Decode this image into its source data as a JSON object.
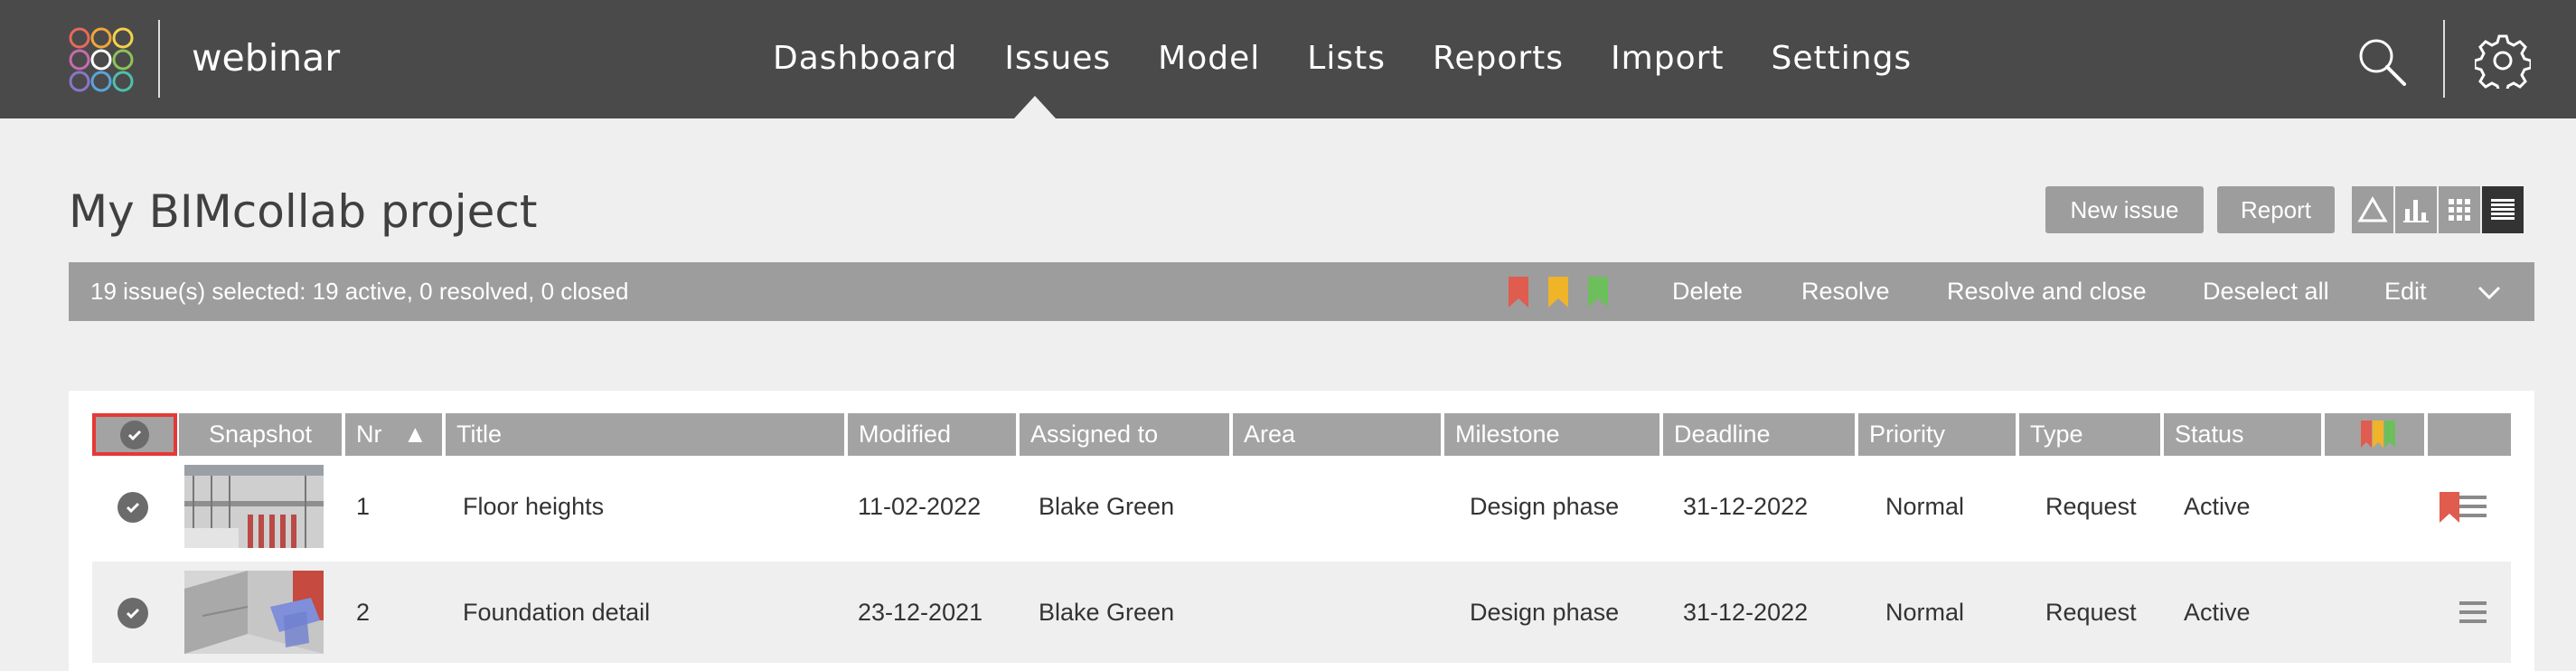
{
  "app": {
    "project_name": "webinar"
  },
  "nav": {
    "items": [
      {
        "label": "Dashboard"
      },
      {
        "label": "Issues"
      },
      {
        "label": "Model"
      },
      {
        "label": "Lists"
      },
      {
        "label": "Reports"
      },
      {
        "label": "Import"
      },
      {
        "label": "Settings"
      }
    ],
    "active": "Issues",
    "icons": {
      "search": "search-icon",
      "settings": "gear-icon"
    }
  },
  "page": {
    "title": "My BIMcollab project",
    "new_issue_label": "New issue",
    "report_label": "Report",
    "view_buttons": [
      "triangle-view-icon",
      "bar-chart-icon",
      "grid-view-icon",
      "list-view-icon"
    ],
    "active_view": "list-view-icon"
  },
  "selection_bar": {
    "summary": "19 issue(s) selected: 19 active, 0 resolved, 0 closed",
    "flags": [
      {
        "color": "#e05c4e"
      },
      {
        "color": "#f0b429"
      },
      {
        "color": "#6cbf5b"
      }
    ],
    "actions": [
      "Delete",
      "Resolve",
      "Resolve and close",
      "Deselect all",
      "Edit"
    ]
  },
  "table": {
    "columns": [
      {
        "key": "snapshot",
        "label": "Snapshot"
      },
      {
        "key": "nr",
        "label": "Nr",
        "sort": "▲"
      },
      {
        "key": "title",
        "label": "Title"
      },
      {
        "key": "modified",
        "label": "Modified"
      },
      {
        "key": "assigned",
        "label": "Assigned to"
      },
      {
        "key": "area",
        "label": "Area"
      },
      {
        "key": "milestone",
        "label": "Milestone"
      },
      {
        "key": "deadline",
        "label": "Deadline"
      },
      {
        "key": "priority",
        "label": "Priority"
      },
      {
        "key": "type",
        "label": "Type"
      },
      {
        "key": "status",
        "label": "Status"
      }
    ],
    "rows": [
      {
        "nr": "1",
        "title": "Floor heights",
        "modified": "11-02-2022",
        "assigned": "Blake Green",
        "area": "",
        "milestone": "Design phase",
        "deadline": "31-12-2022",
        "priority": "Normal",
        "type": "Request",
        "status": "Active",
        "flag": "#e05c4e"
      },
      {
        "nr": "2",
        "title": "Foundation detail",
        "modified": "23-12-2021",
        "assigned": "Blake Green",
        "area": "",
        "milestone": "Design phase",
        "deadline": "31-12-2022",
        "priority": "Normal",
        "type": "Request",
        "status": "Active",
        "flag": ""
      }
    ]
  },
  "colors": {
    "navbar": "#4a4a4a",
    "header_cell": "#a3a3a3",
    "selection_bar": "#9d9d9d",
    "select_all_outline": "#e53935"
  }
}
